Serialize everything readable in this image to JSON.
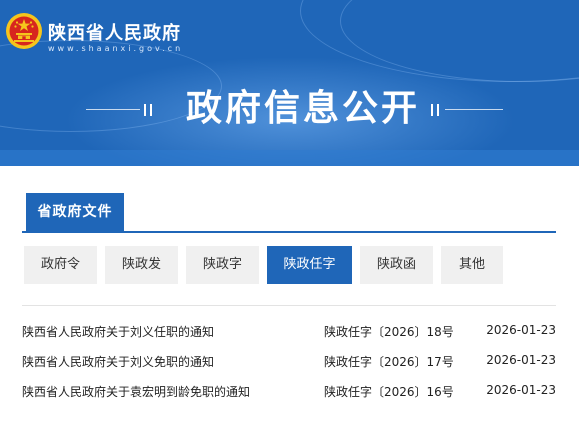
{
  "header": {
    "site_name": "陕西省人民政府",
    "site_url": "www.shaanxi.gov.cn",
    "hero_title": "政府信息公开"
  },
  "section": {
    "tab_label": "省政府文件"
  },
  "categories": [
    {
      "label": "政府令",
      "active": false
    },
    {
      "label": "陕政发",
      "active": false
    },
    {
      "label": "陕政字",
      "active": false
    },
    {
      "label": "陕政任字",
      "active": true
    },
    {
      "label": "陕政函",
      "active": false
    },
    {
      "label": "其他",
      "active": false
    }
  ],
  "documents": [
    {
      "title": "陕西省人民政府关于刘义任职的通知",
      "number": "陕政任字〔2026〕18号",
      "date": "2026-01-23"
    },
    {
      "title": "陕西省人民政府关于刘义免职的通知",
      "number": "陕政任字〔2026〕17号",
      "date": "2026-01-23"
    },
    {
      "title": "陕西省人民政府关于袁宏明到龄免职的通知",
      "number": "陕政任字〔2026〕16号",
      "date": "2026-01-23"
    }
  ],
  "colors": {
    "primary": "#1f66b8",
    "button_bg": "#f0f0f0",
    "emblem_red": "#d7261e",
    "emblem_gold": "#f5c51c"
  },
  "icons": {
    "emblem": "national-emblem-icon"
  }
}
